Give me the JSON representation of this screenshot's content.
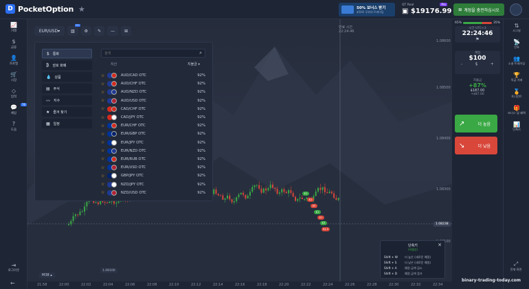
{
  "header": {
    "brand": "PocketOption",
    "bonus_title": "50% 보너스 받기",
    "bonus_sub": "$50로 무위의 트레이딩",
    "account_type": "QT Real",
    "account_badge": "Pro",
    "balance": "$19176.99",
    "deposit_label": "계정을 충전하십시오"
  },
  "leftnav": [
    {
      "icon": "chart-icon",
      "glyph": "📈",
      "label": "거래"
    },
    {
      "icon": "dollar-icon",
      "glyph": "$",
      "label": "금융"
    },
    {
      "icon": "user-icon",
      "glyph": "👤",
      "label": "프로필"
    },
    {
      "icon": "cart-icon",
      "glyph": "🛒",
      "label": "시장"
    },
    {
      "icon": "diamond-icon",
      "glyph": "◇",
      "label": "업적"
    },
    {
      "icon": "chat-icon",
      "glyph": "💬",
      "label": "채팅",
      "badge": "76"
    },
    {
      "icon": "help-icon",
      "glyph": "?",
      "label": "도움"
    }
  ],
  "leftnav_bottom": {
    "logout": "로그아웃"
  },
  "toolbar": {
    "pair": "EUR/USD",
    "interval_badge": "M5"
  },
  "picker": {
    "categories": [
      {
        "icon": "dollar-icon",
        "glyph": "$",
        "label": "통화",
        "active": true
      },
      {
        "icon": "bitcoin-icon",
        "glyph": "₿",
        "label": "암호 화폐"
      },
      {
        "icon": "drop-icon",
        "glyph": "💧",
        "label": "상품"
      },
      {
        "icon": "doc-icon",
        "glyph": "▤",
        "label": "주식"
      },
      {
        "icon": "index-icon",
        "glyph": "〰",
        "label": "지수"
      },
      {
        "icon": "star-icon",
        "glyph": "★",
        "label": "즐겨 찾기"
      },
      {
        "icon": "calendar-icon",
        "glyph": "▦",
        "label": "일정"
      }
    ],
    "search_placeholder": "검색",
    "col_asset": "자산",
    "col_payout": "지불금",
    "assets": [
      {
        "name": "AUD/CAD OTC",
        "payout": "92%",
        "c1": "#1f3a93",
        "c2": "#d52b1e"
      },
      {
        "name": "AUD/CHF OTC",
        "payout": "92%",
        "c1": "#1f3a93",
        "c2": "#d52b1e"
      },
      {
        "name": "AUD/NZD OTC",
        "payout": "92%",
        "c1": "#1f3a93",
        "c2": "#1f3a93"
      },
      {
        "name": "AUD/USD OTC",
        "payout": "92%",
        "c1": "#1f3a93",
        "c2": "#b22234"
      },
      {
        "name": "CAD/CHF OTC",
        "payout": "92%",
        "c1": "#d52b1e",
        "c2": "#d52b1e"
      },
      {
        "name": "CAD/JPY OTC",
        "payout": "92%",
        "c1": "#d52b1e",
        "c2": "#ffffff"
      },
      {
        "name": "EUR/CHF OTC",
        "payout": "92%",
        "c1": "#003399",
        "c2": "#d52b1e"
      },
      {
        "name": "EUR/GBP OTC",
        "payout": "92%",
        "c1": "#003399",
        "c2": "#012169"
      },
      {
        "name": "EUR/JPY OTC",
        "payout": "92%",
        "c1": "#003399",
        "c2": "#ffffff"
      },
      {
        "name": "EUR/NZD OTC",
        "payout": "92%",
        "c1": "#003399",
        "c2": "#1f3a93"
      },
      {
        "name": "EUR/RUB OTC",
        "payout": "92%",
        "c1": "#003399",
        "c2": "#d52b1e"
      },
      {
        "name": "EUR/USD OTC",
        "payout": "92%",
        "c1": "#003399",
        "c2": "#b22234"
      },
      {
        "name": "GBP/JPY OTC",
        "payout": "92%",
        "c1": "#012169",
        "c2": "#ffffff"
      },
      {
        "name": "NZD/JPY OTC",
        "payout": "92%",
        "c1": "#1f3a93",
        "c2": "#ffffff"
      },
      {
        "name": "NZD/USD OTC",
        "payout": "92%",
        "c1": "#1f3a93",
        "c2": "#b22234"
      }
    ]
  },
  "chart": {
    "time_caption": "만료 시간",
    "time_value": "22:24:46",
    "y_ticks": [
      "1.08600",
      "1.08500",
      "1.08400",
      "1.08300",
      "1.08238",
      "1.08100"
    ],
    "x_ticks": [
      "21:58",
      "22:00",
      "22:02",
      "22:04",
      "22:06",
      "22:08",
      "22:10",
      "22:12",
      "22:14",
      "22:16",
      "22:18",
      "22:20",
      "22:22",
      "22:24",
      "22:26",
      "22:28",
      "22:30",
      "22:32",
      "22:34"
    ],
    "current_price": "1.08238",
    "low_label": "1.08100",
    "interval_label": "M38"
  },
  "rightpanel": {
    "sentiment_left": "65%",
    "sentiment_right": "35%",
    "time_label": "시간 UTC+3",
    "time_value": "22:24:46",
    "amount_label": "계정",
    "amount_value": "$100",
    "payout_label": "지불금",
    "payout_pct": "+87%",
    "payout_amount": "$187.00",
    "profit": "+$87.00",
    "up_label": "더 높음",
    "down_label": "더 낮음"
  },
  "rightnav": [
    {
      "icon": "signal-icon",
      "glyph": "⇅",
      "label": "시그널"
    },
    {
      "icon": "antenna-icon",
      "glyph": "📡",
      "label": "신호"
    },
    {
      "icon": "users-icon",
      "glyph": "👥",
      "label": "소셜 트레이딩"
    },
    {
      "icon": "trophy-icon",
      "glyph": "🏆",
      "label": "직급 거래"
    },
    {
      "icon": "trophy2-icon",
      "glyph": "🏅",
      "label": "토너먼트"
    },
    {
      "icon": "bonus-icon",
      "glyph": "🎁",
      "label": "보너스 및 혜택"
    },
    {
      "icon": "chart2-icon",
      "glyph": "📊",
      "label": "단축키"
    }
  ],
  "rightnav_bottom": {
    "fullscreen": "전체 화면"
  },
  "shortcuts": {
    "title": "단축키",
    "subtitle": "(비활성)",
    "rows": [
      {
        "key": "Shift + W",
        "desc": "더 높은 (새로운 예정)"
      },
      {
        "key": "Shift + S",
        "desc": "더 낮은 (새로운 예정)"
      },
      {
        "key": "Shift + A",
        "desc": "예정 금액 감소"
      },
      {
        "key": "Shift + D",
        "desc": "예정 금액 증가"
      }
    ]
  },
  "watermark": "binary-trading-today.com"
}
